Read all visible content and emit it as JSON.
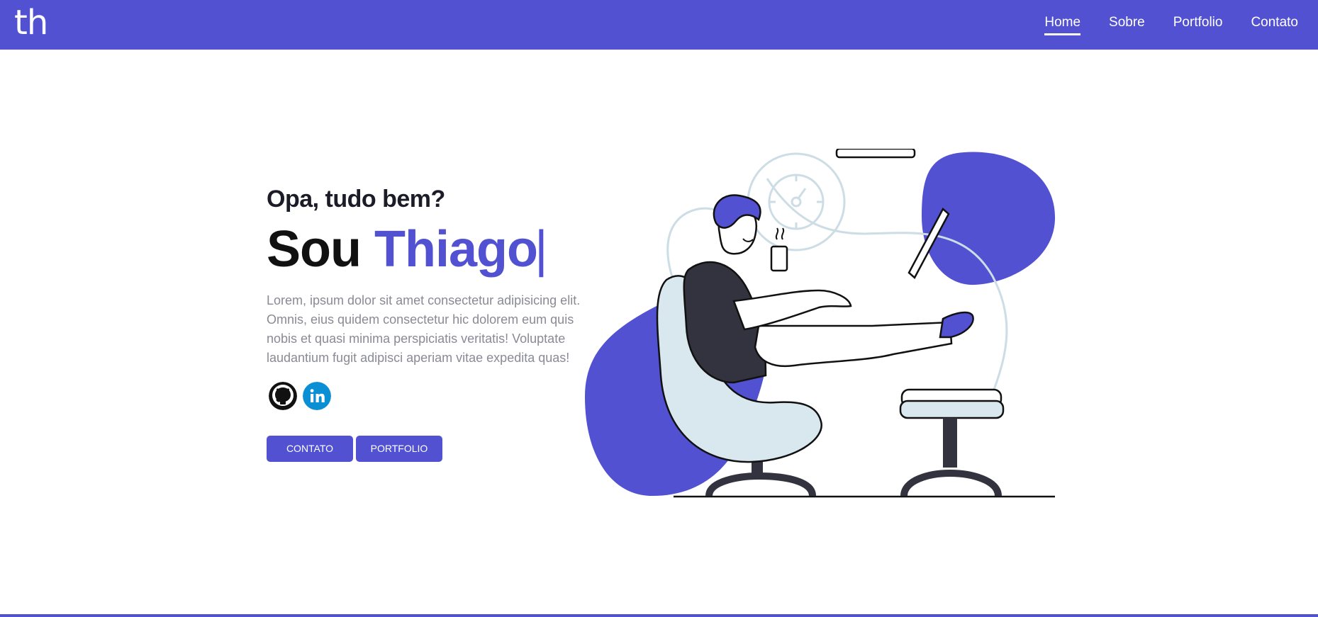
{
  "brand": {
    "logo_text": "th"
  },
  "nav": {
    "items": [
      {
        "label": "Home",
        "active": true
      },
      {
        "label": "Sobre",
        "active": false
      },
      {
        "label": "Portfolio",
        "active": false
      },
      {
        "label": "Contato",
        "active": false
      }
    ]
  },
  "hero": {
    "greeting": "Opa, tudo bem?",
    "headline_prefix": "Sou",
    "headline_name": "Thiago",
    "cursor": "|",
    "intro": "Lorem, ipsum dolor sit amet consectetur adipisicing elit. Omnis, eius quidem consectetur hic dolorem eum quis nobis et quasi minima perspiciatis veritatis! Voluptate laudantium fugit adipisci aperiam vitae expedita quas!",
    "socials": [
      {
        "icon": "github-icon"
      },
      {
        "icon": "linkedin-icon"
      }
    ],
    "buttons": {
      "contact": "CONTATO",
      "portfolio": "PORTFOLIO"
    }
  },
  "colors": {
    "accent": "#5151d2",
    "text_dark": "#1c1c28",
    "text_muted": "#8a8a96",
    "linkedin": "#0a8ed4",
    "chair": "#d9e8ef",
    "sweater": "#33333f"
  }
}
